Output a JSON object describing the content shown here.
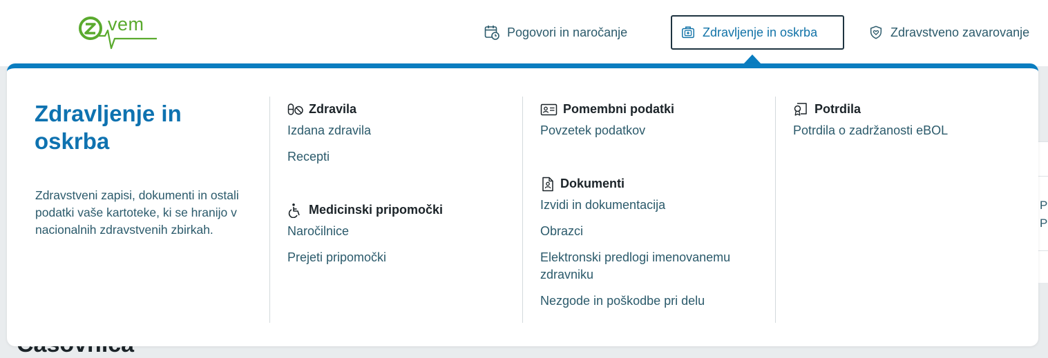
{
  "logo": {
    "text": "vem"
  },
  "nav": [
    {
      "label": "Pogovori in naročanje",
      "icon": "calendar-clock-icon"
    },
    {
      "label": "Zdravljenje in oskrba",
      "icon": "medical-bag-icon",
      "active": true
    },
    {
      "label": "Zdravstveno zavarovanje",
      "icon": "shield-heart-icon"
    }
  ],
  "menu": {
    "title": "Zdravljenje in oskrba",
    "description": "Zdravstveni zapisi, dokumenti in ostali podatki vaše kartoteke, ki se hranijo v nacionalnih zdravstvenih zbirkah.",
    "sections": {
      "zdravila": {
        "title": "Zdravila",
        "icon": "pills-icon",
        "links": [
          "Izdana zdravila",
          "Recepti"
        ]
      },
      "pripomocki": {
        "title": "Medicinski pripomočki",
        "icon": "wheelchair-icon",
        "links": [
          "Naročilnice",
          "Prejeti pripomočki"
        ]
      },
      "podatki": {
        "title": "Pomembni podatki",
        "icon": "id-card-icon",
        "links": [
          "Povzetek podatkov"
        ]
      },
      "dokumenti": {
        "title": "Dokumenti",
        "icon": "document-user-icon",
        "links": [
          "Izvidi in dokumentacija",
          "Obrazci",
          "Elektronski predlogi imenovanemu zdravniku",
          "Nezgode in poškodbe pri delu"
        ]
      },
      "potrdila": {
        "title": "Potrdila",
        "icon": "certificate-icon",
        "links": [
          "Potrdila o zadržanosti eBOL"
        ]
      }
    }
  },
  "background": {
    "heading": "Časovnica",
    "card_text": "P"
  },
  "colors": {
    "accent": "#0a7dc0",
    "link": "#2b5a6b",
    "brand_green": "#5aaa2e"
  }
}
